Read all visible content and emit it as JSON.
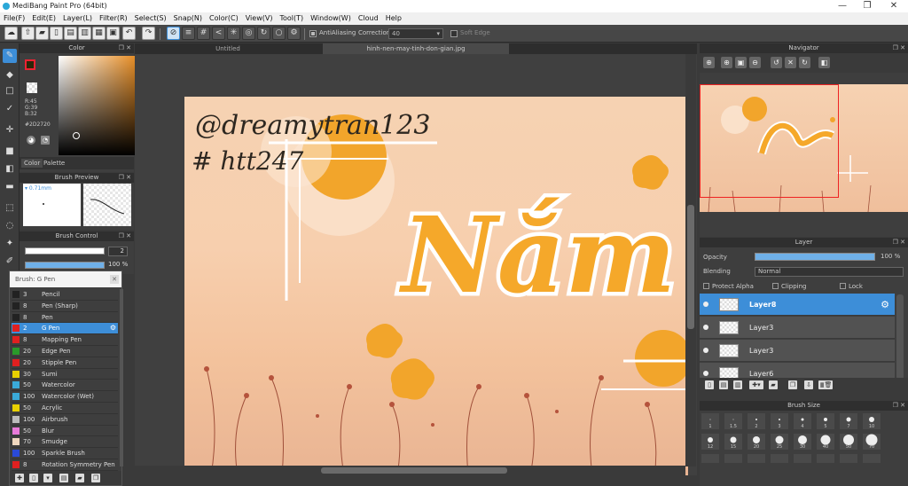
{
  "window": {
    "title": "MediBang Paint Pro (64bit)",
    "minimize": "—",
    "maximize": "❐",
    "close": "✕"
  },
  "menu": [
    "File(F)",
    "Edit(E)",
    "Layer(L)",
    "Filter(R)",
    "Select(S)",
    "Snap(N)",
    "Color(C)",
    "View(V)",
    "Tool(T)",
    "Window(W)",
    "Cloud",
    "Help"
  ],
  "toolbar": {
    "antialiasing_label": "AntiAliasing",
    "correction_label": "Correction",
    "correction_value": "40",
    "soft_edge_label": "Soft Edge"
  },
  "color_panel": {
    "title": "Color",
    "r": "R:45",
    "g": "G:39",
    "b": "B:32",
    "hex": "#2D2720",
    "tab_color": "Color",
    "tab_palette": "Palette",
    "fg_color": "#2d2720"
  },
  "brush_preview": {
    "title": "Brush Preview",
    "size": "0.71mm"
  },
  "brush_control": {
    "title": "Brush Control",
    "size_value": "2",
    "opacity_value": "100 %"
  },
  "brush_list": {
    "title": "Brush: G Pen",
    "items": [
      {
        "size": "3",
        "name": "Pencil",
        "color": "#222222"
      },
      {
        "size": "8",
        "name": "Pen (Sharp)",
        "color": "#222222"
      },
      {
        "size": "8",
        "name": "Pen",
        "color": "#222222"
      },
      {
        "size": "2",
        "name": "G Pen",
        "color": "#e02020",
        "selected": true
      },
      {
        "size": "8",
        "name": "Mapping Pen",
        "color": "#e02020"
      },
      {
        "size": "20",
        "name": "Edge Pen",
        "color": "#2a9a2a"
      },
      {
        "size": "20",
        "name": "Stipple Pen",
        "color": "#e02020"
      },
      {
        "size": "30",
        "name": "Sumi",
        "color": "#e8d000"
      },
      {
        "size": "50",
        "name": "Watercolor",
        "color": "#3aaad8"
      },
      {
        "size": "100",
        "name": "Watercolor (Wet)",
        "color": "#3aaad8"
      },
      {
        "size": "50",
        "name": "Acrylic",
        "color": "#e8d000"
      },
      {
        "size": "100",
        "name": "Airbrush",
        "color": "#bbbbbb"
      },
      {
        "size": "50",
        "name": "Blur",
        "color": "#e87ad8"
      },
      {
        "size": "70",
        "name": "Smudge",
        "color": "#f0d8c0"
      },
      {
        "size": "100",
        "name": "Sparkle Brush",
        "color": "#2a4ad8"
      },
      {
        "size": "8",
        "name": "Rotation Symmetry Pen",
        "color": "#e02020"
      }
    ]
  },
  "document_tabs": [
    "Untitled",
    "hinh-nen-may-tinh-don-gian.jpg"
  ],
  "artwork": {
    "handle": "@dreamytran123",
    "tag": "# htt247",
    "word": "Nắm"
  },
  "navigator": {
    "title": "Navigator"
  },
  "layer_panel": {
    "title": "Layer",
    "opacity_label": "Opacity",
    "opacity_value": "100 %",
    "blending_label": "Blending",
    "blending_value": "Normal",
    "protect_alpha": "Protect Alpha",
    "clipping": "Clipping",
    "lock": "Lock",
    "layers": [
      {
        "name": "Layer8",
        "selected": true
      },
      {
        "name": "Layer3",
        "selected": false
      },
      {
        "name": "Layer3",
        "selected": false
      },
      {
        "name": "Layer6",
        "selected": false
      }
    ]
  },
  "brush_size_panel": {
    "title": "Brush Size",
    "row1": [
      "1",
      "1.5",
      "2",
      "3",
      "4",
      "5",
      "7",
      "10"
    ],
    "row2": [
      "12",
      "15",
      "20",
      "25",
      "30",
      "40",
      "50",
      "70"
    ]
  }
}
